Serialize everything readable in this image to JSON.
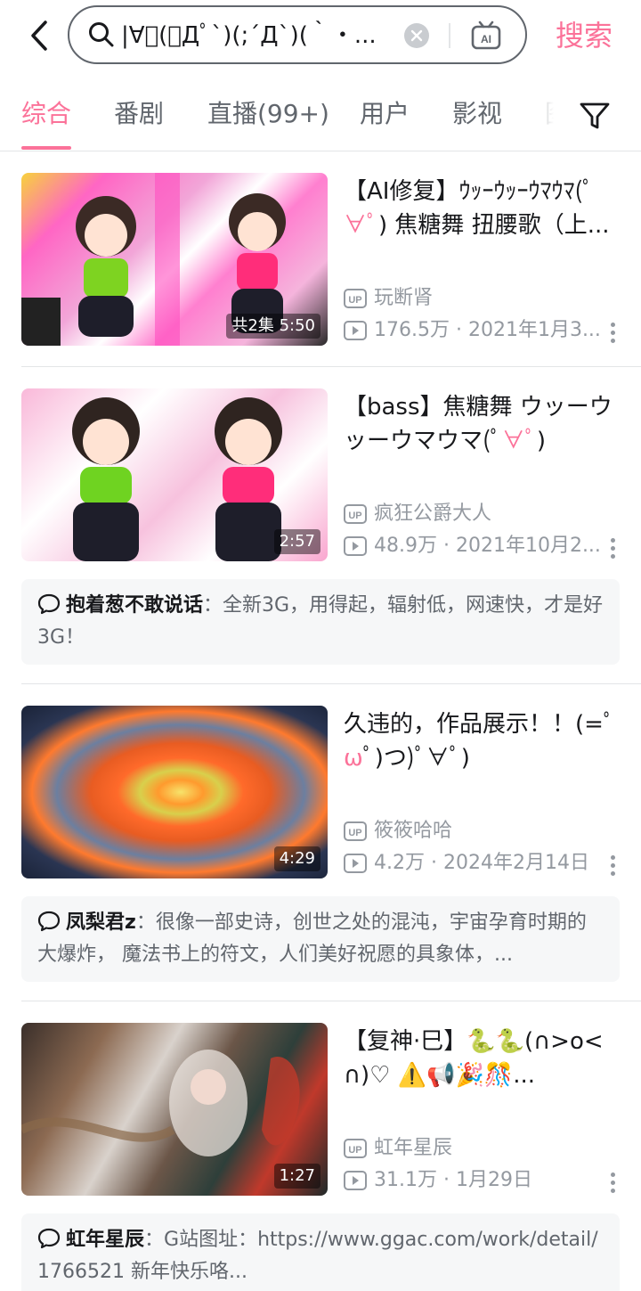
{
  "search": {
    "query": "|∀ﾟ(ﾟДﾟ`)(;´Д`)(｀・...",
    "submit_label": "搜索"
  },
  "tabs": [
    {
      "label": "综合",
      "active": true
    },
    {
      "label": "番剧"
    },
    {
      "label": "直播(99+)"
    },
    {
      "label": "用户"
    },
    {
      "label": "影视"
    },
    {
      "label": "图"
    }
  ],
  "results": [
    {
      "title_a": "【AI修复】ｳｯｰｳｯｰｳﾏｳﾏ(ﾟ",
      "title_em": "∀ﾟ",
      "title_b": ") 焦糖舞 扭腰歌（上...",
      "duration": "共2集 5:50",
      "uploader": "玩断肾",
      "stats": "176.5万 · 2021年1月3..."
    },
    {
      "title_a": "【bass】焦糖舞 ウッーウッーウマウマ(ﾟ",
      "title_em": "∀ﾟ",
      "title_b": ")",
      "duration": "2:57",
      "uploader": "疯狂公爵大人",
      "stats": "48.9万 · 2021年10月2...",
      "comment_user": "抱着葱不敢说话",
      "comment_text": "：全新3G，用得起，辐射低，网速快，才是好3G！"
    },
    {
      "title_a": "久违的，作品展示！！(=ﾟ",
      "title_em": "ω",
      "title_b": "ﾟ)つ)ﾟ∀ﾟ)",
      "duration": "4:29",
      "uploader": "筱筱哈哈",
      "stats": "4.2万 · 2024年2月14日",
      "comment_user": "凤梨君z",
      "comment_text": "：很像一部史诗，创世之处的混沌，宇宙孕育时期的大爆炸， 魔法书上的符文，人们美好祝愿的具象体，..."
    },
    {
      "title_a": "【复神·巳】🐍🐍(∩>o<∩)♡ ⚠️📢🎉🎊...",
      "title_em": "",
      "title_b": "",
      "duration": "1:27",
      "uploader": "虹年星辰",
      "stats": "31.1万 · 1月29日",
      "comment_user": "虹年星辰",
      "comment_text": "：G站图址：https://www.ggac.com/work/detail/1766521 新年快乐咯..."
    }
  ],
  "colors": {
    "accent": "#fb7299",
    "text_secondary": "#9499a0",
    "comment_bg": "#f6f7f8"
  }
}
